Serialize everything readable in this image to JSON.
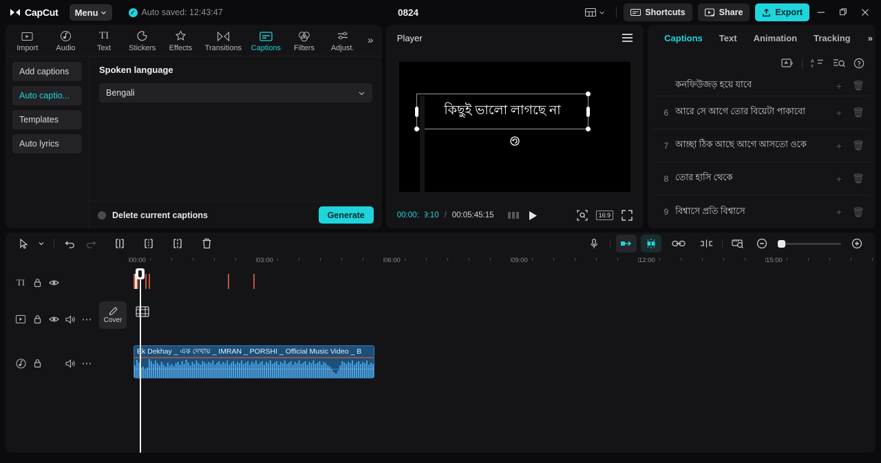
{
  "titlebar": {
    "app_name": "CapCut",
    "menu_label": "Menu",
    "autosave": "Auto saved: 12:43:47",
    "project_title": "0824",
    "shortcuts_label": "Shortcuts",
    "share_label": "Share",
    "export_label": "Export",
    "accent": "#1fd4dc"
  },
  "toolbar": {
    "items": [
      {
        "label": "Import",
        "icon": "import-icon"
      },
      {
        "label": "Audio",
        "icon": "audio-icon"
      },
      {
        "label": "Text",
        "icon": "text-icon"
      },
      {
        "label": "Stickers",
        "icon": "stickers-icon"
      },
      {
        "label": "Effects",
        "icon": "effects-icon"
      },
      {
        "label": "Transitions",
        "icon": "transitions-icon"
      },
      {
        "label": "Captions",
        "icon": "captions-icon"
      },
      {
        "label": "Filters",
        "icon": "filters-icon"
      },
      {
        "label": "Adjust.",
        "icon": "adjust-icon"
      }
    ],
    "active_index": 6,
    "more_label": "»"
  },
  "left_panel": {
    "side_buttons": [
      {
        "label": "Add captions"
      },
      {
        "label": "Auto captio..."
      },
      {
        "label": "Templates"
      },
      {
        "label": "Auto lyrics"
      }
    ],
    "active_side_index": 1,
    "section_title": "Spoken language",
    "language_value": "Bengali",
    "delete_label": "Delete current captions",
    "generate_label": "Generate"
  },
  "player": {
    "title": "Player",
    "caption_text": "কিছুই ভালো লাগছে না",
    "current_time": "00:00:19:10",
    "time_separator": "/",
    "total_time": "00:05:45:15",
    "ratio": "16:9"
  },
  "right_panel": {
    "tabs": [
      {
        "label": "Captions"
      },
      {
        "label": "Text"
      },
      {
        "label": "Animation"
      },
      {
        "label": "Tracking"
      }
    ],
    "active_tab_index": 0,
    "more_label": "»",
    "captions": [
      {
        "num": "",
        "text": "কনফিউজড় হয়ে যাবে",
        "partial": true
      },
      {
        "num": "6",
        "text": "আরে সে আগে তোর বিয়েটা পাকাবো",
        "partial": false
      },
      {
        "num": "7",
        "text": "আচ্ছা ঠিক আছে আগে আসতো ওকে",
        "partial": false
      },
      {
        "num": "8",
        "text": "তোর হাসি থেকে",
        "partial": false
      },
      {
        "num": "9",
        "text": "বিশ্বাসে প্রতি বিশ্বাসে",
        "partial": false
      }
    ],
    "row_add_icon": "plus-icon",
    "row_delete_icon": "trash-icon"
  },
  "timeline": {
    "ruler_ticks": [
      "00:00",
      "03:00",
      "06:00",
      "09:00",
      "12:00",
      "15:00"
    ],
    "cover_label": "Cover",
    "audio_clip_label": "Ek Dekhay _ এক দেখায় _ IMRAN _ PORSHI _ Official Music Video _ B",
    "tools": [
      {
        "icon": "select-arrow-icon"
      },
      {
        "icon": "chevron-down-icon"
      },
      {
        "icon": "undo-icon"
      },
      {
        "icon": "redo-icon"
      },
      {
        "icon": "split-icon"
      },
      {
        "icon": "trim-start-icon"
      },
      {
        "icon": "trim-end-icon"
      },
      {
        "icon": "delete-icon"
      }
    ],
    "right_tools": [
      {
        "icon": "microphone-icon"
      },
      {
        "icon": "keyframe-icon"
      },
      {
        "icon": "magnet-icon"
      },
      {
        "icon": "link-icon"
      },
      {
        "icon": "adjust-clip-icon"
      },
      {
        "icon": "preview-icon"
      },
      {
        "icon": "zoom-out-icon"
      },
      {
        "icon": "zoom-in-icon"
      }
    ]
  }
}
